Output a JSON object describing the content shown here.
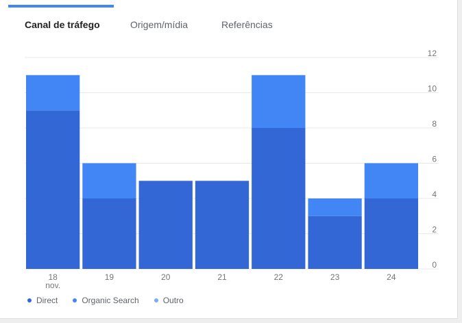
{
  "tabs": [
    {
      "label": "Canal de tráfego",
      "active": true
    },
    {
      "label": "Origem/mídia",
      "active": false
    },
    {
      "label": "Referências",
      "active": false
    }
  ],
  "colors": {
    "direct": "#3367d6",
    "organic": "#4285f4",
    "outro": "#7baaf7",
    "grid": "#e8e8e8"
  },
  "chart_data": {
    "type": "bar",
    "stacked": true,
    "categories": [
      "18",
      "19",
      "20",
      "21",
      "22",
      "23",
      "24"
    ],
    "category_sublabels": [
      "nov.",
      "",
      "",
      "",
      "",
      "",
      ""
    ],
    "series": [
      {
        "name": "Direct",
        "values": [
          9,
          4,
          5,
          5,
          8,
          3,
          4
        ]
      },
      {
        "name": "Organic Search",
        "values": [
          2,
          2,
          0,
          0,
          3,
          1,
          2
        ]
      },
      {
        "name": "Outro",
        "values": [
          0,
          0,
          0,
          0,
          0,
          0,
          0
        ]
      }
    ],
    "yticks": [
      0,
      2,
      4,
      6,
      8,
      10,
      12
    ],
    "ylim": [
      0,
      12
    ],
    "y_axis_side": "right",
    "grid": true,
    "legend_position": "bottom-left"
  }
}
